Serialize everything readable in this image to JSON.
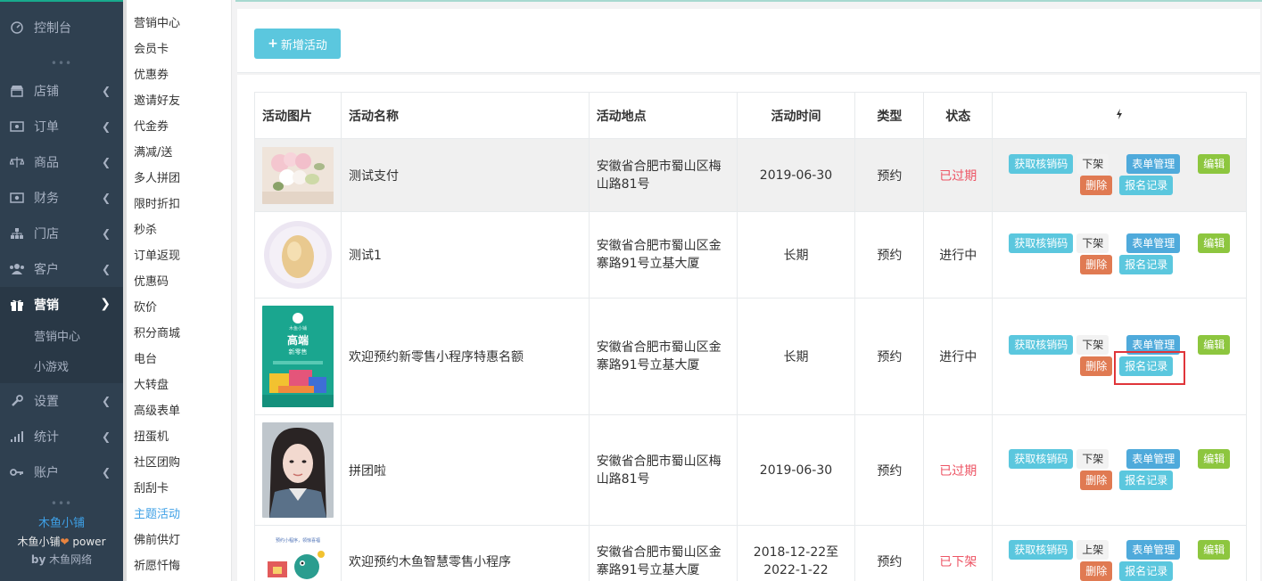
{
  "sidebar": {
    "items": [
      {
        "label": "控制台",
        "icon": "dashboard-icon"
      },
      {
        "label": "店铺",
        "icon": "shop-icon"
      },
      {
        "label": "订单",
        "icon": "order-icon"
      },
      {
        "label": "商品",
        "icon": "goods-icon"
      },
      {
        "label": "财务",
        "icon": "finance-icon"
      },
      {
        "label": "门店",
        "icon": "store-icon"
      },
      {
        "label": "客户",
        "icon": "customer-icon"
      },
      {
        "label": "营销",
        "icon": "gift-icon"
      },
      {
        "label": "设置",
        "icon": "wrench-icon"
      },
      {
        "label": "统计",
        "icon": "bar-chart-icon"
      },
      {
        "label": "账户",
        "icon": "key-icon"
      }
    ],
    "sub_items": [
      "营销中心",
      "小游戏"
    ],
    "dots": "•••",
    "brand": {
      "name": "木鱼小铺",
      "power_prefix": "木鱼小铺",
      "power_suffix": "power",
      "by_prefix": "by",
      "by_name": "木鱼网络"
    }
  },
  "secondary_menu": [
    "营销中心",
    "会员卡",
    "优惠券",
    "邀请好友",
    "代金券",
    "满减/送",
    "多人拼团",
    "限时折扣",
    "秒杀",
    "订单返现",
    "优惠码",
    "砍价",
    "积分商城",
    "电台",
    "大转盘",
    "高级表单",
    "扭蛋机",
    "社区团购",
    "刮刮卡",
    "主题活动",
    "佛前供灯",
    "祈愿忏悔"
  ],
  "secondary_active": "主题活动",
  "toolbar": {
    "add_label": "新增活动"
  },
  "table": {
    "headers": [
      "活动图片",
      "活动名称",
      "活动地点",
      "活动时间",
      "类型",
      "状态"
    ],
    "ops_header_icon": "bolt-icon",
    "rows": [
      {
        "name": "测试支付",
        "addr1": "安徽省合肥市蜀山区梅",
        "addr2": "山路81号",
        "time1": "2019-06-30",
        "time2": "",
        "type": "预约",
        "status": "已过期",
        "shelf": "下架"
      },
      {
        "name": "测试1",
        "addr1": "安徽省合肥市蜀山区金",
        "addr2": "寨路91号立基大厦",
        "time1": "长期",
        "time2": "",
        "type": "预约",
        "status": "进行中",
        "shelf": "下架"
      },
      {
        "name": "欢迎预约新零售小程序特惠名额",
        "addr1": "安徽省合肥市蜀山区金",
        "addr2": "寨路91号立基大厦",
        "time1": "长期",
        "time2": "",
        "type": "预约",
        "status": "进行中",
        "shelf": "下架"
      },
      {
        "name": "拼团啦",
        "addr1": "安徽省合肥市蜀山区梅",
        "addr2": "山路81号",
        "time1": "2019-06-30",
        "time2": "",
        "type": "预约",
        "status": "已过期",
        "shelf": "下架"
      },
      {
        "name": "欢迎预约木鱼智慧零售小程序",
        "addr1": "安徽省合肥市蜀山区金",
        "addr2": "寨路91号立基大厦",
        "time1": "2018-12-22至",
        "time2": "2022-1-22",
        "type": "预约",
        "status": "已下架",
        "shelf": "上架"
      }
    ],
    "ops": {
      "verify": "获取核销码",
      "form": "表单管理",
      "edit": "编辑",
      "delete": "删除",
      "records": "报名记录"
    }
  },
  "poster": {
    "brand": "木鱼小铺",
    "title": "高端",
    "subtitle": "新零售",
    "tagline": "预约小程序，领惊喜福"
  }
}
